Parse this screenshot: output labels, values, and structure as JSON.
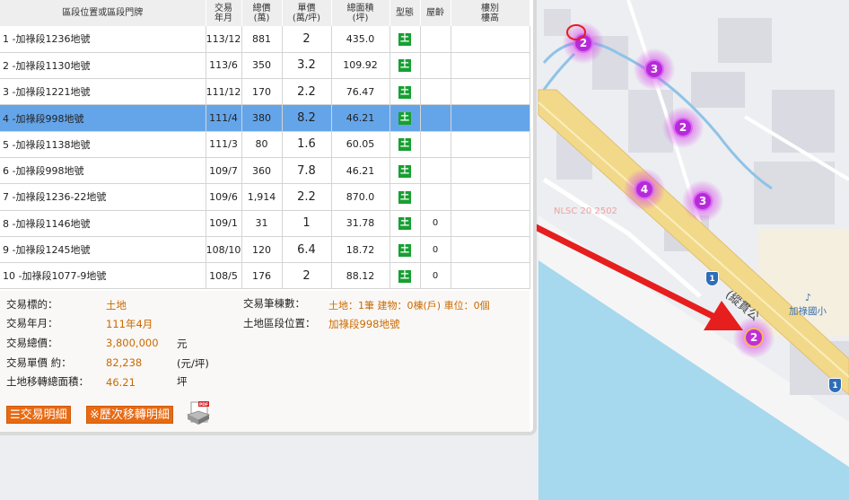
{
  "table": {
    "headers": {
      "address": "區段位置或區段門牌",
      "date": [
        "交易",
        "年月"
      ],
      "total": [
        "總價",
        "(萬)"
      ],
      "unit": [
        "單價",
        "(萬/坪)"
      ],
      "area": [
        "總面積",
        "(坪)"
      ],
      "type": "型態",
      "age": "屋齡",
      "floor": [
        "樓別",
        "樓高"
      ]
    },
    "rows": [
      {
        "address": "1 -加祿段1236地號",
        "date": "113/12",
        "total": "881",
        "unit": "2",
        "area": "435.0",
        "type": "土",
        "age": "",
        "floor": ""
      },
      {
        "address": "2 -加祿段1130地號",
        "date": "113/6",
        "total": "350",
        "unit": "3.2",
        "area": "109.92",
        "type": "土",
        "age": "",
        "floor": ""
      },
      {
        "address": "3 -加祿段1221地號",
        "date": "111/12",
        "total": "170",
        "unit": "2.2",
        "area": "76.47",
        "type": "土",
        "age": "",
        "floor": ""
      },
      {
        "address": "4 -加祿段998地號",
        "date": "111/4",
        "total": "380",
        "unit": "8.2",
        "area": "46.21",
        "type": "土",
        "age": "",
        "floor": ""
      },
      {
        "address": "5 -加祿段1138地號",
        "date": "111/3",
        "total": "80",
        "unit": "1.6",
        "area": "60.05",
        "type": "土",
        "age": "",
        "floor": ""
      },
      {
        "address": "6 -加祿段998地號",
        "date": "109/7",
        "total": "360",
        "unit": "7.8",
        "area": "46.21",
        "type": "土",
        "age": "",
        "floor": ""
      },
      {
        "address": "7 -加祿段1236-22地號",
        "date": "109/6",
        "total": "1,914",
        "unit": "2.2",
        "area": "870.0",
        "type": "土",
        "age": "",
        "floor": ""
      },
      {
        "address": "8 -加祿段1146地號",
        "date": "109/1",
        "total": "31",
        "unit": "1",
        "area": "31.78",
        "type": "土",
        "age": "0",
        "floor": ""
      },
      {
        "address": "9 -加祿段1245地號",
        "date": "108/10",
        "total": "120",
        "unit": "6.4",
        "area": "18.72",
        "type": "土",
        "age": "0",
        "floor": ""
      },
      {
        "address": "10 -加祿段1077-9地號",
        "date": "108/5",
        "total": "176",
        "unit": "2",
        "area": "88.12",
        "type": "土",
        "age": "0",
        "floor": ""
      }
    ],
    "selected_row": 3
  },
  "detail": {
    "target_label": "交易標的：",
    "target_value": "土地",
    "date_label": "交易年月：",
    "date_value": "111年4月",
    "total_label": "交易總價：",
    "total_value": "3,800,000",
    "total_unit": "元",
    "unit_label": "交易單價 約：",
    "unit_value": "82,238",
    "unit_unit": "(元/坪)",
    "area_label": "土地移轉總面積：",
    "area_value": "46.21",
    "area_unit": "坪",
    "count_label": "交易筆棟數：",
    "count_value": "土地：1筆 建物：0棟(戶) 車位：0個",
    "section_label": "土地區段位置：",
    "section_value": "加祿段998地號",
    "btn_detail": "交易明細",
    "btn_history": "※歷次移轉明細"
  },
  "map": {
    "clusters": [
      "2",
      "3",
      "2",
      "4",
      "3",
      "2"
    ],
    "watermark": "NLSC 20 2502",
    "school_label": "加祿國小",
    "road_label": "(縱貫公",
    "shield_label": "1",
    "accent_color": "#e61e1e"
  }
}
